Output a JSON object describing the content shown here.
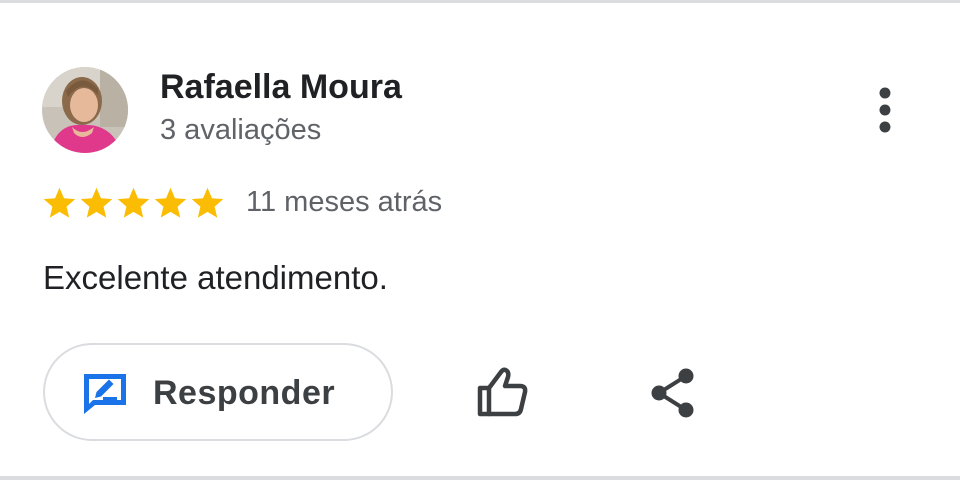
{
  "review": {
    "author_name": "Rafaella Moura",
    "review_count": "3 avaliações",
    "rating": 5,
    "rating_max": 5,
    "time_ago": "11 meses atrás",
    "text": "Excelente atendimento."
  },
  "actions": {
    "reply_label": "Responder"
  },
  "icons": {
    "avatar": "profile-photo",
    "more": "more-vert-icon",
    "star": "star-icon",
    "reply": "reply-comment-icon",
    "like": "thumb-up-icon",
    "share": "share-icon"
  },
  "colors": {
    "star": "#fbbc04",
    "reply_icon": "#1a73e8",
    "text_primary": "#202124",
    "text_secondary": "#5f6368",
    "divider": "#dadce0"
  }
}
